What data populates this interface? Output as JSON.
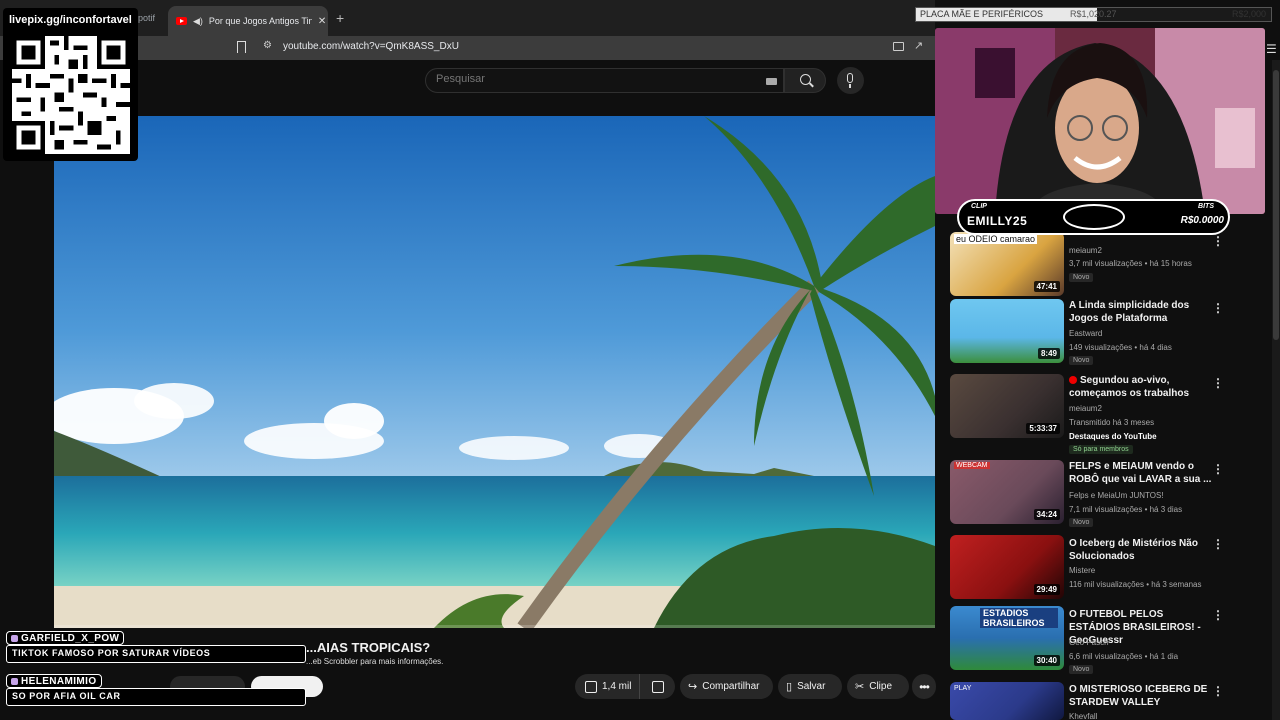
{
  "browser": {
    "prev_tab_label": "potif",
    "active_tab_title": "Por que Jogos Antigos Tinham",
    "new_tab_symbol": "+",
    "url": "youtube.com/watch?v=QmK8ASS_DxU"
  },
  "youtube": {
    "search_placeholder": "Pesquisar",
    "video": {
      "title": "...AIAS TROPICAIS?",
      "scrobbler_note": "...eb Scrobbler para mais informações.",
      "likes": "1,4 mil",
      "share_label": "Compartilhar",
      "save_label": "Salvar",
      "clip_label": "Clipe",
      "more_symbol": "•••"
    },
    "recommendations": [
      {
        "thumb_text": "eu ODEIO camarao",
        "duration": "47:41",
        "title": "",
        "channel": "meiaum2",
        "meta": "3,7 mil visualizações • há 15 horas",
        "badge": "Novo",
        "thumb_color": "#d9a441"
      },
      {
        "thumb_text": "",
        "duration": "8:49",
        "title": "A Linda simplicidade dos Jogos de Plataforma",
        "channel": "Eastward",
        "meta": "149 visualizações • há 4 dias",
        "badge": "Novo",
        "thumb_color": "#5bb7e8"
      },
      {
        "thumb_text": "",
        "duration": "5:33:37",
        "title": "Segundou ao-vivo, começamos os trabalhos",
        "channel": "meiaum2",
        "meta": "Transmitido há 3 meses",
        "extra": "Destaques do YouTube",
        "members": "Só para membros",
        "thumb_color": "#3a3030"
      },
      {
        "thumb_text": "WEBCAM",
        "duration": "34:24",
        "title": "FELPS e MEIAUM vendo o ROBÔ que vai LAVAR a sua ...",
        "channel": "Felps e MeiaUm JUNTOS!",
        "meta": "7,1 mil visualizações • há 3 dias",
        "badge": "Novo",
        "thumb_color": "#6a4a5a"
      },
      {
        "thumb_text": "",
        "duration": "29:49",
        "title": "O Iceberg de Mistérios Não Solucionados",
        "channel": "Mistere",
        "meta": "116 mil visualizações • há 3 semanas",
        "thumb_color": "#8a1010"
      },
      {
        "thumb_text": "ESTADIOS BRASILEIROS",
        "duration": "30:40",
        "title": "O FUTEBOL PELOS ESTÁDIOS BRASILEIROS! - GeoGuessr",
        "channel": "Geo Pasch",
        "meta": "6,6 mil visualizações • há 1 dia",
        "badge": "Novo",
        "thumb_color": "#2a6fb0"
      },
      {
        "thumb_text": "PLAY",
        "duration": "",
        "title": "O MISTERIOSO ICEBERG DE STARDEW VALLEY",
        "channel": "Khevfall",
        "meta": "",
        "thumb_color": "#2b3a8a"
      }
    ]
  },
  "overlay": {
    "livepix_label": "livepix.gg/inconfortavel",
    "goal": {
      "label": "PLACA MÃE E PERIFÉRICOS",
      "current": "R$1,020.27",
      "target": "R$2,000",
      "progress": 0.51
    },
    "sub_banner": {
      "name": "EMILLY25",
      "tag_left": "CLIP",
      "tag_right": "BITS",
      "amount": "R$0.0000"
    },
    "chat": [
      {
        "user": "GARFIELD_X_POW",
        "text": "TIKTOK FAMOSO POR SATURAR VÍDEOS"
      },
      {
        "user": "HELENAMIMIO",
        "text": "SO POR AFIA OIL CAR"
      }
    ]
  },
  "colors": {
    "background": "#0f0f0f",
    "accent_red": "#ff0000",
    "chip": "#272727"
  }
}
